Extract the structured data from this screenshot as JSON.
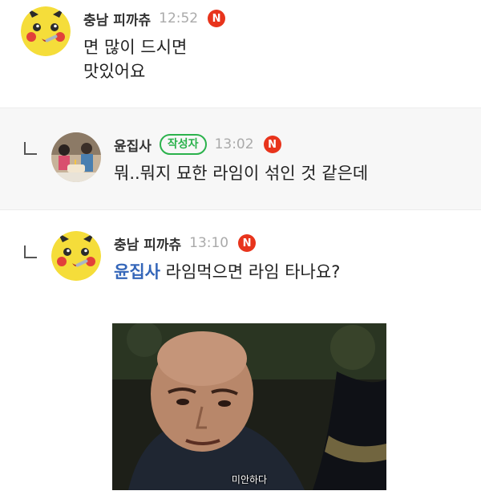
{
  "comments": [
    {
      "nickname": "충남 피까츄",
      "time": "12:52",
      "badge": "N",
      "text_lines": [
        "면 많이 드시면",
        "맛있어요"
      ],
      "avatar_icon": "pikachu-icon"
    },
    {
      "nickname": "윤집사",
      "author_badge": "작성자",
      "time": "13:02",
      "badge": "N",
      "text": "뭐..뭐지 묘한 라임이 섞인 것 같은데",
      "avatar_icon": "family-photo"
    },
    {
      "nickname": "충남 피까츄",
      "time": "13:10",
      "badge": "N",
      "mention": "윤집사",
      "text": " 라임먹으면 라임 타나요?",
      "avatar_icon": "pikachu-icon",
      "gif_caption": "미안하다"
    }
  ],
  "colors": {
    "badge_red": "#e8341c",
    "author_green": "#2bb24c",
    "mention_blue": "#3466b9",
    "reply_bg": "#f7f7f7"
  }
}
